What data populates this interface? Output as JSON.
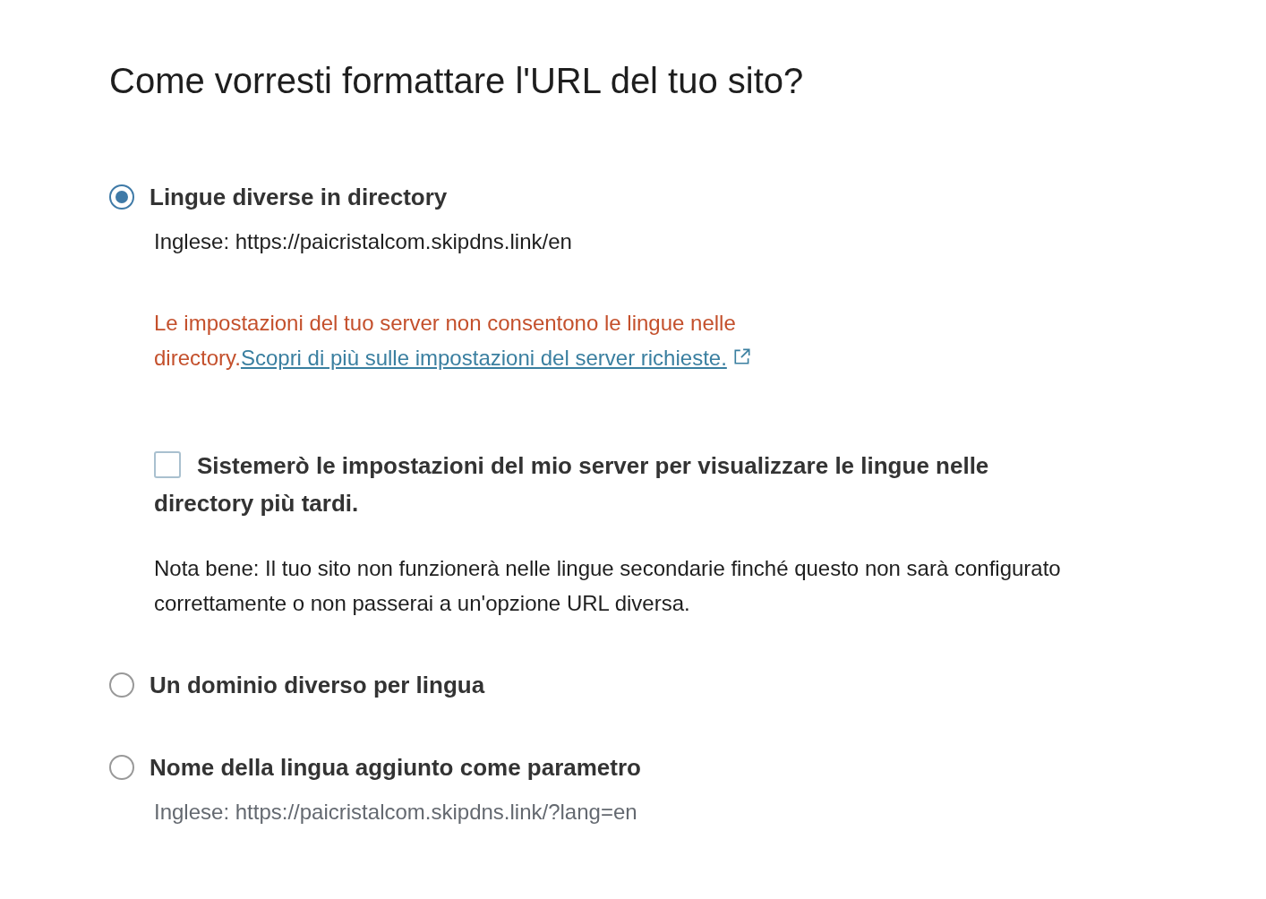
{
  "heading": "Come vorresti formattare l'URL del tuo sito?",
  "options": [
    {
      "label": "Lingue diverse in directory",
      "selected": true,
      "example": "Inglese: https://paicristalcom.skipdns.link/en",
      "warning": {
        "text": "Le impostazioni del tuo server non consentono le lingue nelle directory.",
        "link": "Scopri di più sulle impostazioni del server richieste."
      },
      "confirm": {
        "label": "Sistemerò le impostazioni del mio server per visualizzare le lingue nelle directory più tardi.",
        "checked": false
      },
      "note": "Nota bene: Il tuo sito non funzionerà nelle lingue secondarie finché questo non sarà configurato correttamente o non passerai a un'opzione URL diversa."
    },
    {
      "label": "Un dominio diverso per lingua",
      "selected": false
    },
    {
      "label": "Nome della lingua aggiunto come parametro",
      "selected": false,
      "example": "Inglese: https://paicristalcom.skipdns.link/?lang=en"
    }
  ]
}
